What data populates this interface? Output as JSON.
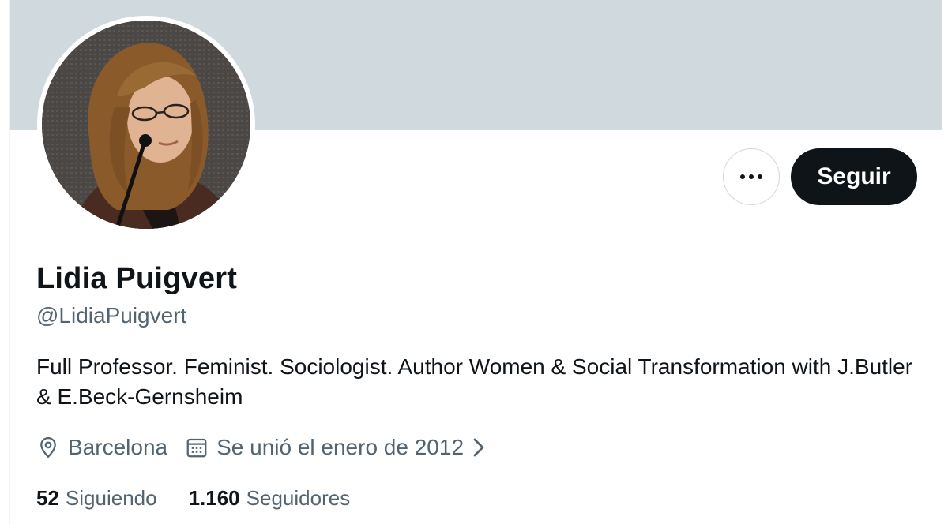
{
  "profile": {
    "name": "Lidia Puigvert",
    "handle": "@LidiaPuigvert",
    "bio": "Full Professor. Feminist. Sociologist. Author Women & Social Transformation with J.Butler & E.Beck-Gernsheim",
    "location": "Barcelona",
    "joined": "Se unió el enero de 2012"
  },
  "actions": {
    "follow_label": "Seguir",
    "more_icon": "more-horizontal-icon"
  },
  "stats": {
    "following_count": "52",
    "following_label": "Siguiendo",
    "followers_count": "1.160",
    "followers_label": "Seguidores"
  },
  "icons": {
    "location": "location-pin-icon",
    "calendar": "calendar-icon",
    "chevron": "chevron-right-icon"
  },
  "colors": {
    "banner": "#cfd9de",
    "primary_text": "#0f1419",
    "secondary_text": "#536471",
    "button_bg": "#0f1419"
  }
}
